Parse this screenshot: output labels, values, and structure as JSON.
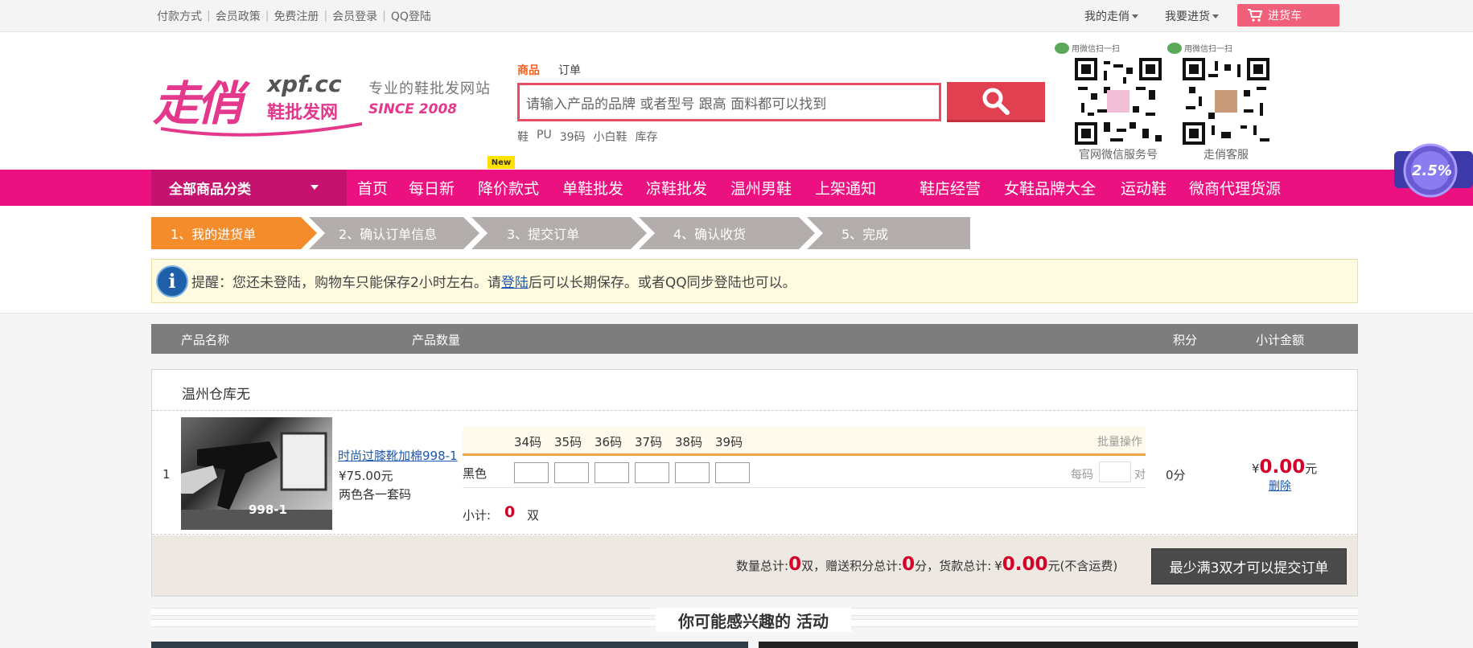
{
  "topbar": {
    "links": [
      "付款方式",
      "会员政策",
      "免费注册",
      "会员登录",
      "QQ登陆"
    ],
    "my_zouqiao": "我的走俏",
    "restock": "我要进货",
    "cart": "进货车"
  },
  "header": {
    "logo_text": "走俏",
    "logo_domain": "xpf.cc",
    "logo_sub": "鞋批发网",
    "slogan": "专业的鞋批发网站",
    "since": "SINCE 2008",
    "search_tabs": [
      "商品",
      "订单"
    ],
    "search_placeholder": "请输入产品的品牌 或者型号 跟高 面料都可以找到",
    "hot_keywords": [
      "鞋",
      "PU",
      "39码",
      "小白鞋",
      "库存"
    ],
    "qr": [
      {
        "scan": "用微信扫一扫",
        "label": "官网微信服务号"
      },
      {
        "scan": "用微信扫一扫",
        "label": "走俏客服"
      }
    ]
  },
  "nav": {
    "all_categories": "全部商品分类",
    "items": [
      "首页",
      "每日新",
      "降价款式",
      "单鞋批发",
      "凉鞋批发",
      "温州男鞋",
      "上架通知",
      "鞋店经营",
      "女鞋品牌大全",
      "运动鞋",
      "微商代理货源"
    ],
    "new_badge": "New"
  },
  "steps": [
    "1、我的进货单",
    "2、确认订单信息",
    "3、提交订单",
    "4、确认收货",
    "5、完成"
  ],
  "notice": {
    "before": "提醒：您还未登陆，购物车只能保存2小时左右。请",
    "link": "登陆",
    "after": "后可以长期保存。或者QQ同步登陆也可以。"
  },
  "table": {
    "headers": [
      "产品名称",
      "产品数量",
      "积分",
      "小计金额"
    ]
  },
  "store": {
    "name": "温州仓库无",
    "item": {
      "index": "1",
      "title": "时尚过膝靴加棉998-1",
      "price": "¥75.00元",
      "note": "两色各一套码",
      "image_tag": "998-1",
      "sizes": [
        "34码",
        "35码",
        "36码",
        "37码",
        "38码",
        "39码"
      ],
      "bulk": "批量操作",
      "color": "黑色",
      "per_size_label": "每码",
      "pair_unit": "对",
      "subtotal_label": "小计:",
      "subtotal_qty": "0",
      "subtotal_unit": "双",
      "points": "0分",
      "amount_currency": "¥",
      "amount": "0.00",
      "amount_unit": "元",
      "delete": "删除"
    }
  },
  "totals": {
    "qty_label": "数量总计:",
    "qty": "0",
    "qty_unit": "双，",
    "points_label": "赠送积分总计:",
    "points": "0",
    "points_unit": "分，",
    "goods_label": "货款总计:",
    "currency": "¥",
    "goods": "0.00",
    "goods_unit": "元(不含运费)",
    "submit": "最少满3双才可以提交订单"
  },
  "activities": {
    "title": "你可能感兴趣的 活动"
  },
  "float_badge": "2.5%",
  "colors": {
    "pink": "#ec1181",
    "dark_pink": "#c6126f",
    "orange": "#f58c2c",
    "red": "#d4002a"
  }
}
